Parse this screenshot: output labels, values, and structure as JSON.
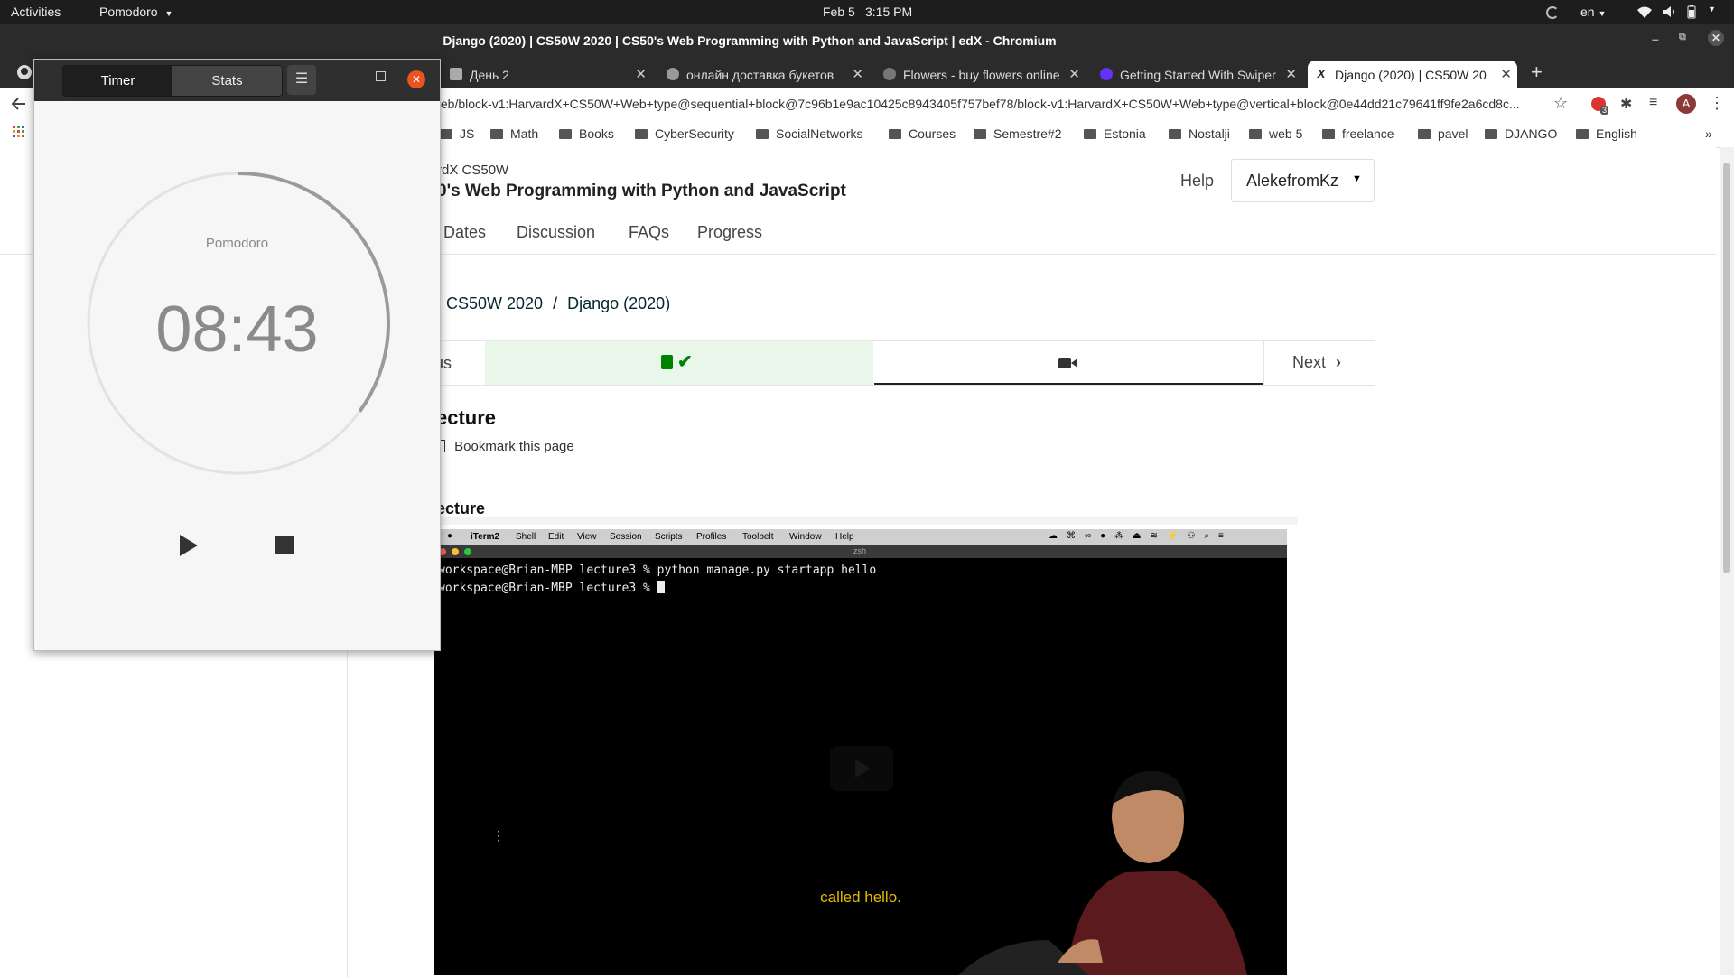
{
  "topbar": {
    "activities": "Activities",
    "app_menu": "Pomodoro",
    "datetime_date": "Feb 5",
    "datetime_time": "3:15 PM",
    "lang": "en"
  },
  "browser": {
    "window_title": "Django (2020) | CS50W 2020 | CS50's Web Programming with Python and JavaScript | edX - Chromium",
    "tabs": [
      {
        "title": "День 2",
        "color": "#888"
      },
      {
        "title": "онлайн доставка букетов",
        "color": "#888"
      },
      {
        "title": "Flowers - buy flowers online",
        "color": "#888"
      },
      {
        "title": "Getting Started With Swiper",
        "color": "#6332f6"
      },
      {
        "title": "Django (2020) | CS50W 2020",
        "color": "#02262b"
      }
    ],
    "url": "/eb/block-v1:HarvardX+CS50W+Web+type@sequential+block@7c96b1e9ac10425c8943405f757bef78/block-v1:HarvardX+CS50W+Web+type@vertical+block@0e44dd21c79641ff9fe2a6cd8c...",
    "bookmarks": [
      "JS",
      "Math",
      "Books",
      "CyberSecurity",
      "SocialNetworks",
      "Courses",
      "Semestre#2",
      "Estonia",
      "Nostalji",
      "web 5",
      "freelance",
      "pavel",
      "DJANGO",
      "English"
    ],
    "extension_badge": "3",
    "profile_initial": "A"
  },
  "edx": {
    "org": "rdX CS50W",
    "course_title": "0's Web Programming with Python and JavaScript",
    "help": "Help",
    "user": "AlekefromKz",
    "nav": [
      "Dates",
      "Discussion",
      "FAQs",
      "Progress"
    ],
    "breadcrumb_course": "CS50W 2020",
    "breadcrumb_sep": "/",
    "breadcrumb_section": "Django (2020)",
    "prev_label": "us",
    "next_label": "Next",
    "unit_title": "ecture",
    "bookmark_label": "Bookmark this page",
    "video_heading": "ecture",
    "accent": "#02262b",
    "complete_color": "#008100"
  },
  "video": {
    "menubar": [
      "iTerm2",
      "Shell",
      "Edit",
      "View",
      "Session",
      "Scripts",
      "Profiles",
      "Toolbelt",
      "Window",
      "Help"
    ],
    "term_tab": "zsh",
    "term_line1": "workspace@Brian-MBP lecture3 % python manage.py startapp hello",
    "term_line2": "workspace@Brian-MBP lecture3 % ",
    "caption": "called hello.",
    "caption_color": "#e6b800"
  },
  "pomodoro": {
    "tab_timer": "Timer",
    "tab_stats": "Stats",
    "mode_label": "Pomodoro",
    "time": "08:43",
    "progress_remaining": 0.35
  }
}
